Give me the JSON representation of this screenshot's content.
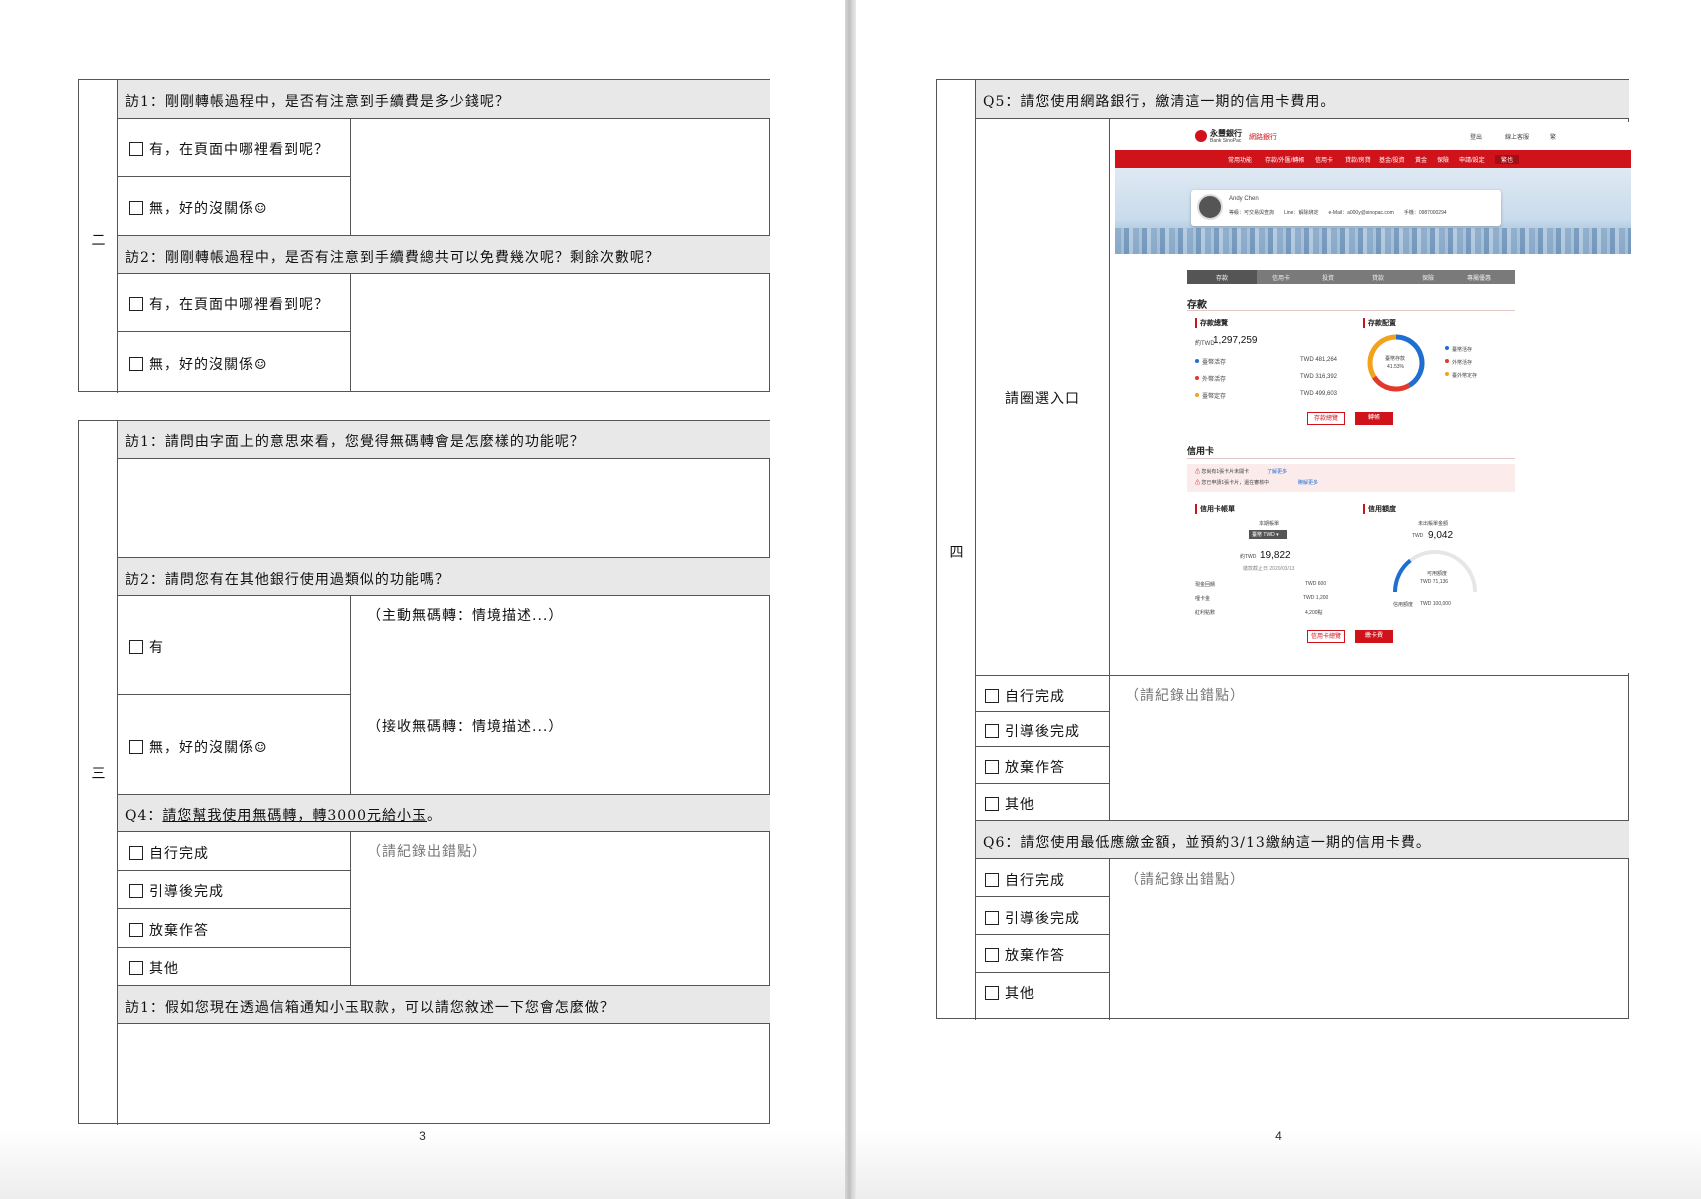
{
  "page3": {
    "number": "3",
    "table2": {
      "section": "二",
      "q1": "訪1：剛剛轉帳過程中，是否有注意到手續費是多少錢呢？",
      "q1_yes": "有，在頁面中哪裡看到呢？",
      "q1_no": "無，好的沒關係☺",
      "q2": "訪2：剛剛轉帳過程中，是否有注意到手續費總共可以免費幾次呢？剩餘次數呢？",
      "q2_yes": "有，在頁面中哪裡看到呢？",
      "q2_no": "無，好的沒關係☺"
    },
    "table3": {
      "section": "三",
      "q1": "訪1：請問由字面上的意思來看，您覺得無碼轉會是怎麼樣的功能呢？",
      "q2": "訪2：請問您有在其他銀行使用過類似的功能嗎？",
      "q2_yes": "有",
      "q2_no": "無，好的沒關係☺",
      "scenario_active": "（主動無碼轉：情境描述...）",
      "scenario_receive": "（接收無碼轉：情境描述...）",
      "q4_prefix": "Q4：",
      "q4_text": "請您幫我使用無碼轉，轉3000元給小玉",
      "q4_suffix": "。",
      "opt_self": "自行完成",
      "opt_guided": "引導後完成",
      "opt_abandon": "放棄作答",
      "opt_other": "其他",
      "record_hint": "（請紀錄出錯點）",
      "q5": "訪1：假如您現在透過信箱通知小玉取款，可以請您敘述一下您會怎麼做？"
    }
  },
  "page4": {
    "number": "4",
    "section": "四",
    "q5": "Q5：請您使用網路銀行，繳清這一期的信用卡費用。",
    "circle_prompt": "請圈選入口",
    "opt_self": "自行完成",
    "opt_guided": "引導後完成",
    "opt_abandon": "放棄作答",
    "opt_other": "其他",
    "record_hint": "（請紀錄出錯點）",
    "q6": "Q6：請您使用最低應繳金額，並預約3/13繳納這一期的信用卡費。",
    "q6_opt_self": "自行完成",
    "q6_opt_guided": "引導後完成",
    "q6_opt_abandon": "放棄作答",
    "q6_opt_other": "其他",
    "q6_record_hint": "（請紀錄出錯點）"
  },
  "screenshot": {
    "bank_name": "永豐銀行",
    "bank_en": "Bank SinoPac",
    "site_label": "網路銀行",
    "top_links": [
      "登出",
      "線上客服",
      "繁"
    ],
    "nav": [
      "常用功能",
      "存款/外匯/轉帳",
      "信用卡",
      "貸款/房貸",
      "基金/投資",
      "黃金",
      "保險",
      "申請/設定",
      "繁也"
    ],
    "user_name": "Andy Chen",
    "user_line": "等級：可交易與查詢　　Line：解除綁定　　e-Mail：a000y@sinopac.com　　手機：0987000294",
    "tabs": [
      "存款",
      "信用卡",
      "投資",
      "貸款",
      "保險",
      "專屬優惠"
    ],
    "deposit_title": "存款",
    "deposit_total_label": "存款總覽",
    "deposit_currency": "約TWD",
    "deposit_total": "1,297,259",
    "deposit_rows": [
      {
        "name": "臺幣活存",
        "value": "TWD 481,264"
      },
      {
        "name": "外幣活存",
        "value": "TWD 316,392"
      },
      {
        "name": "臺幣定存",
        "value": "TWD 499,603"
      }
    ],
    "allocation_label": "存款配置",
    "donut_center_label": "臺幣存款",
    "donut_center_value": "41.53%",
    "donut_legend": [
      "臺幣活存",
      "外幣活存",
      "臺外幣定存"
    ],
    "btn_deposit_overview": "存款總覽",
    "btn_transfer": "轉帳",
    "card_title": "信用卡",
    "alert1": "您尚有1張卡片未開卡",
    "alert1_link": "了解更多",
    "alert2": "您已申請1張卡片，還在審核中",
    "alert2_link": "瞭解更多",
    "bill_label": "信用卡帳單",
    "bill_period": "本期帳單",
    "bill_select": "臺幣 TWD",
    "bill_currency": "約TWD",
    "bill_amount": "19,822",
    "bill_due": "繳款截止日 2020/03/13",
    "bill_rows": [
      {
        "name": "現金回饋",
        "value": "TWD 600"
      },
      {
        "name": "哩卡金",
        "value": "TWD 1,200"
      },
      {
        "name": "紅利點數",
        "value": "4,200點"
      }
    ],
    "limit_label": "信用額度",
    "unpaid_label": "未出帳單金額",
    "unpaid_value": "9,042",
    "unpaid_currency": "TWD",
    "available_label": "可用額度",
    "available_value": "TWD 71,136",
    "credit_limit_label": "信用額度",
    "credit_limit_value": "TWD 100,000",
    "btn_card_overview": "信用卡總覽",
    "btn_pay": "繳卡費",
    "colors": {
      "brand": "#d0121b",
      "donut_blue": "#1e6fd0",
      "donut_orange": "#f2a21b",
      "donut_red": "#e2392b"
    },
    "donut_shares": [
      0.4153,
      0.2439,
      0.3408
    ],
    "credit_used_fraction": 0.289
  }
}
